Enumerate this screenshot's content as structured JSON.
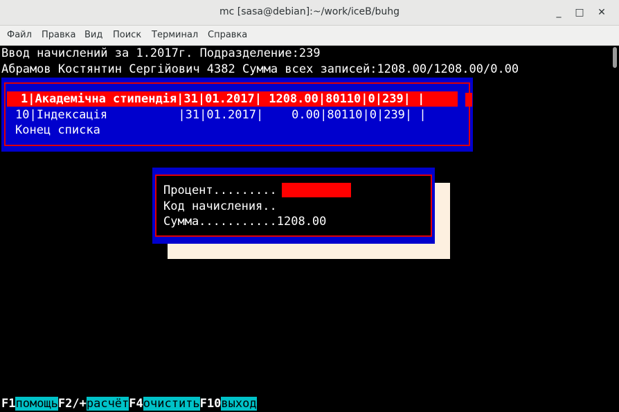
{
  "window": {
    "title": "mc [sasa@debian]:~/work/iceB/buhg",
    "minimize": "_",
    "maximize": "□",
    "close": "✕"
  },
  "menu": [
    "Файл",
    "Правка",
    "Вид",
    "Поиск",
    "Терминал",
    "Справка"
  ],
  "header": {
    "line1": "Ввод начислений за 1.2017г. Подразделение:239",
    "line2": "Абрамов Костянтин Сергійович 4382 Сумма всех записей:1208.00/1208.00/0.00"
  },
  "list": {
    "rows": [
      "1|Академічна стипендія|31|01.2017| 1208.00|80110|0|239| |",
      "10|Індексація          |31|01.2017|    0.00|80110|0|239| |"
    ],
    "end": "Конец списка"
  },
  "dialog": {
    "percent_label": "Процент.........",
    "code_label": "Код начисления..",
    "sum_label": "Сумма...........1208.00"
  },
  "fkeys": [
    {
      "key": "F1",
      "label": "помощь"
    },
    {
      "key": "F2/+",
      "label": "расчёт"
    },
    {
      "key": "F4",
      "label": "очистить"
    },
    {
      "key": "F10",
      "label": "выход"
    }
  ]
}
